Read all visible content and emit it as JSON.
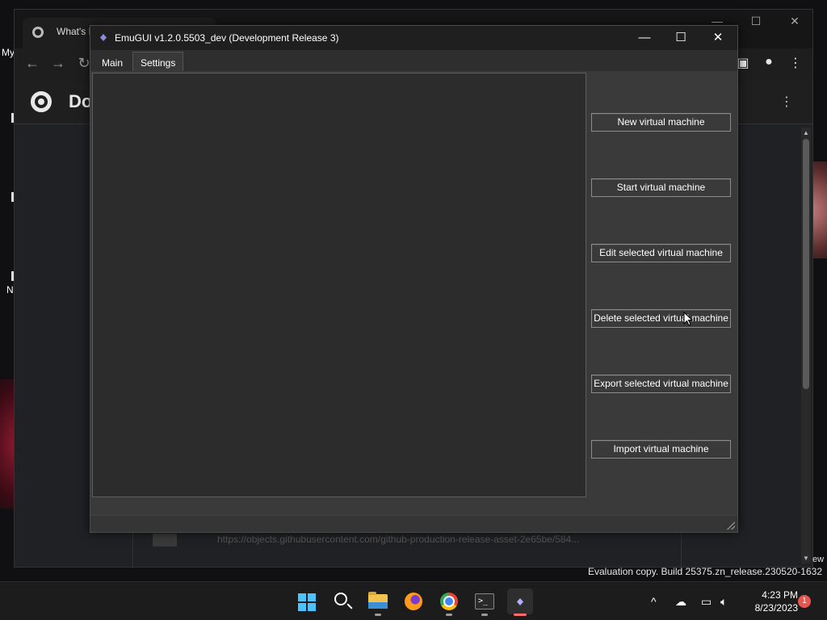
{
  "desktop": {
    "labels": [
      "My",
      "N"
    ]
  },
  "chrome": {
    "tab_title": "What's N",
    "page_title": "Do",
    "nav": {
      "back": "←",
      "forward": "→",
      "reload": "↻"
    },
    "window_controls": {
      "minimize": "—",
      "maximize": "☐",
      "close": "✕"
    },
    "url_snippet": "https://objects.githubusercontent.com/github-production-release-asset-2e65be/584...",
    "corner_text": "ew"
  },
  "emugui": {
    "title": "EmuGUI v1.2.0.5503_dev (Development Release 3)",
    "window_controls": {
      "minimize": "—",
      "maximize": "☐",
      "close": "✕"
    },
    "tabs": [
      {
        "label": "Main",
        "active": true
      },
      {
        "label": "Settings",
        "active": false
      }
    ],
    "buttons": {
      "new_vm": "New virtual machine",
      "start_vm": "Start virtual machine",
      "edit_vm": "Edit selected virtual machine",
      "delete_vm": "Delete selected virtual machine",
      "export_vm": "Export selected virtual machine",
      "import_vm": "Import virtual machine"
    }
  },
  "watermark": "Evaluation copy. Build 25375.zn_release.230520-1632",
  "taskbar": {
    "apps": [
      "start-icon",
      "search-icon",
      "file-explorer-icon",
      "firefox-icon",
      "chrome-icon",
      "terminal-icon",
      "emugui-icon"
    ],
    "tray": {
      "chevron": "^"
    },
    "clock": {
      "time": "4:23 PM",
      "date": "8/23/2023"
    },
    "notification_count": "1"
  },
  "colors": {
    "accent_windows": "#4cc2ff",
    "emu_background": "#3a3a3a",
    "emu_list_background": "#2c2c2c",
    "notification_badge": "#e8554f"
  }
}
